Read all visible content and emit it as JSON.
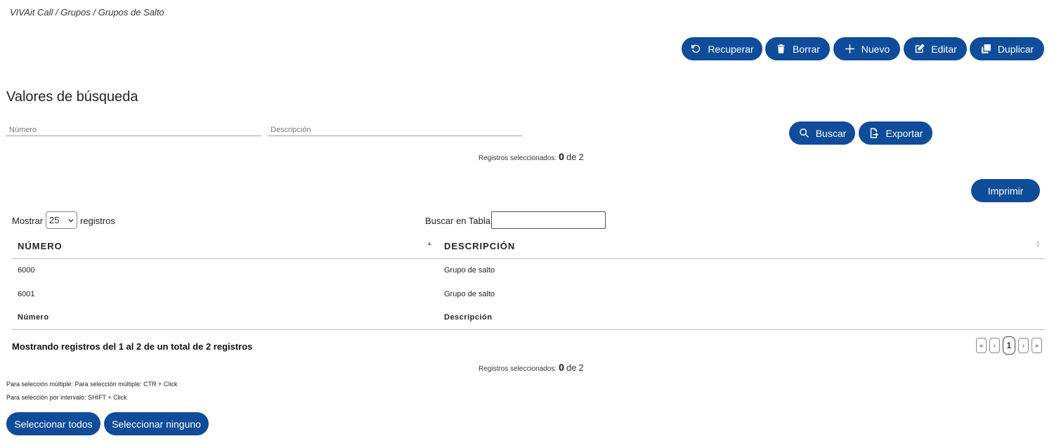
{
  "breadcrumb": "VIVAit Call / Grupos / Grupos de Salto",
  "toolbar": {
    "recuperar": "Recuperar",
    "borrar": "Borrar",
    "nuevo": "Nuevo",
    "editar": "Editar",
    "duplicar": "Duplicar"
  },
  "search": {
    "title": "Valores de búsqueda",
    "numero_placeholder": "Número",
    "descripcion_placeholder": "Descripción",
    "buscar": "Buscar",
    "exportar": "Exportar"
  },
  "selected": {
    "label": "Registros seleccionados:",
    "count": "0",
    "of": "de",
    "total": "2"
  },
  "print": "Imprimir",
  "table_controls": {
    "show_label": "Mostrar",
    "show_value": "25",
    "show_suffix": "registros",
    "search_label": "Buscar en Tabla:"
  },
  "table": {
    "headers": [
      "NÚMERO",
      "DESCRIPCIÓN"
    ],
    "rows": [
      [
        "6000",
        "Grupo de salto"
      ],
      [
        "6001",
        "Grupo de salto"
      ]
    ],
    "footers": [
      "Número",
      "Descripción"
    ]
  },
  "showing": "Mostrando registros del 1 al 2 de un total de 2 registros",
  "pager": {
    "first": "«",
    "prev": "‹",
    "current": "1",
    "next": "›",
    "last": "»"
  },
  "notes": {
    "multi": "Para selección múltiple: Para selección múltiple: CTR + Click",
    "range": "Para selección por intervalo: SHIFT + Click"
  },
  "select_all": "Seleccionar todos",
  "select_none": "Seleccionar ninguno",
  "colors": {
    "primary": "#0f4c99"
  }
}
